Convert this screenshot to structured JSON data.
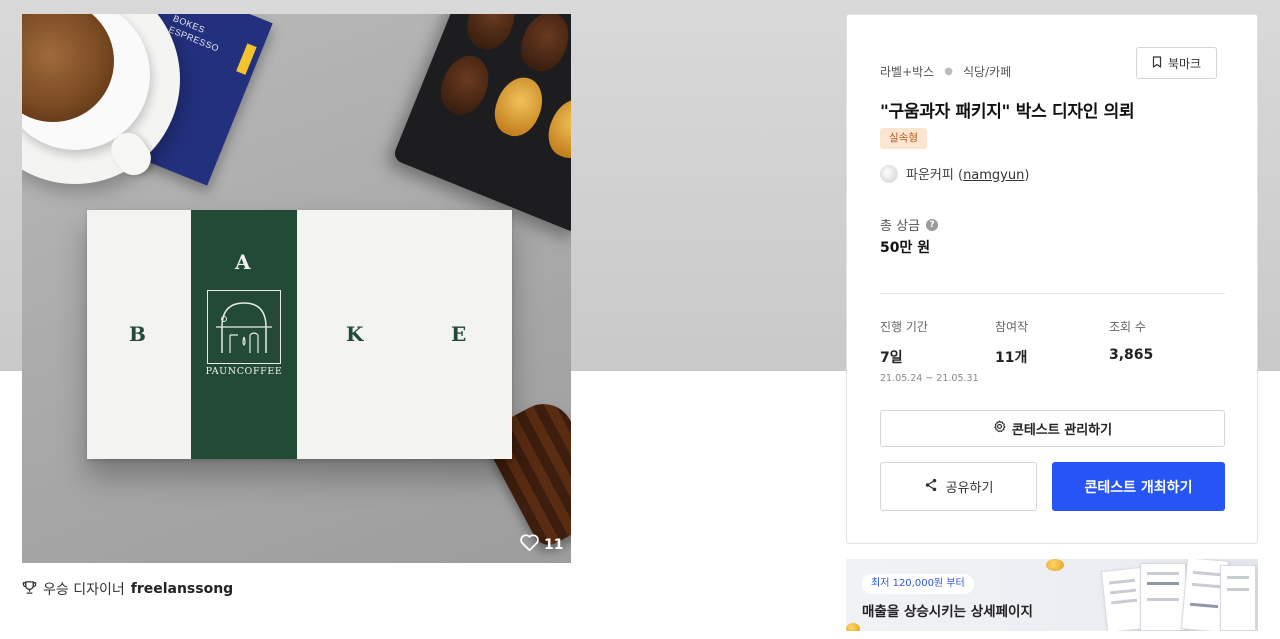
{
  "hero": {
    "pack_text": "BOKES\nESPRESSO",
    "box_letters": [
      "B",
      "A",
      "K",
      "E"
    ],
    "box_logo_text": "PAUNCOFFEE",
    "like_count": "11",
    "like_icon": "heart-outline-icon"
  },
  "award": {
    "icon": "trophy-icon",
    "label": "우승 디자이너",
    "designer": "freelanssong"
  },
  "contest": {
    "breadcrumb": [
      "라벨+박스",
      "식당/카페"
    ],
    "bookmark_label": "북마크",
    "title": "\"구움과자 패키지\" 박스 디자인 의뢰",
    "badge": "실속형",
    "host_name": "파운커피",
    "host_id": "namgyun",
    "prize_label": "총 상금",
    "prize_value": "50만 원",
    "stats": {
      "period_label": "진행 기간",
      "period_value": "7일",
      "period_range": "21.05.24 ~ 21.05.31",
      "entries_label": "참여작",
      "entries_value": "11개",
      "views_label": "조회 수",
      "views_value": "3,865"
    },
    "manage_label": "콘테스트 관리하기",
    "share_label": "공유하기",
    "host_button_label": "콘테스트 개최하기"
  },
  "ad": {
    "pill": "최저 120,000원 부터",
    "title": "매출을 상승시키는 상세페이지"
  },
  "colors": {
    "primary": "#2654f5",
    "badge_bg": "#fce6d2",
    "badge_text": "#b5591c",
    "box_green": "#234a36"
  }
}
